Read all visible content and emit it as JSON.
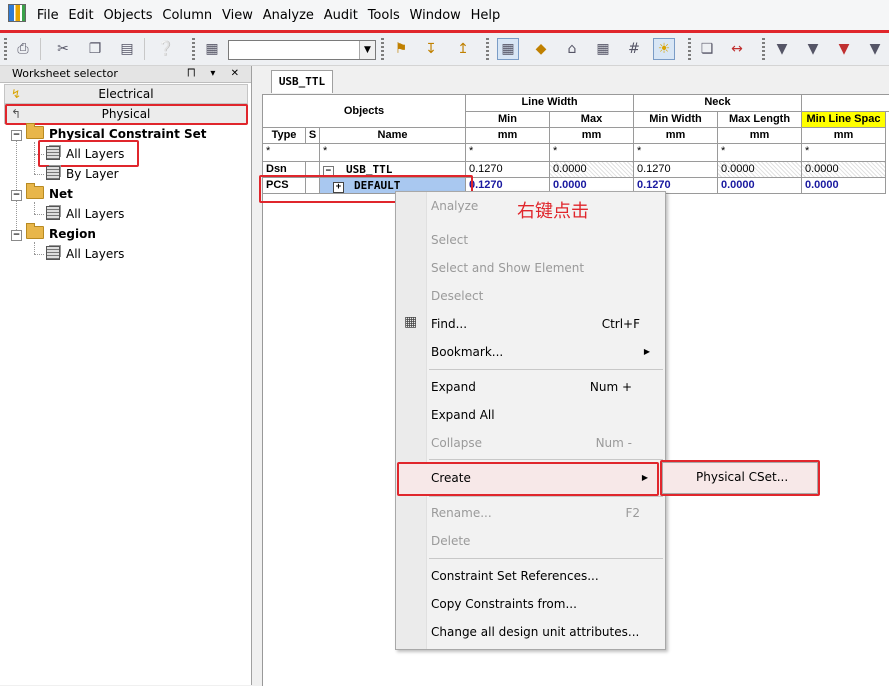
{
  "menubar": [
    "File",
    "Edit",
    "Objects",
    "Column",
    "View",
    "Analyze",
    "Audit",
    "Tools",
    "Window",
    "Help"
  ],
  "left_panel": {
    "title": "Worksheet selector",
    "controls": "⨅ ▾ ✕",
    "electrical": "Electrical",
    "physical": "Physical",
    "tree": [
      {
        "label": "Physical Constraint Set"
      },
      {
        "label": "All Layers"
      },
      {
        "label": "By Layer"
      },
      {
        "label": "Net"
      },
      {
        "label": "All Layers"
      },
      {
        "label": "Region"
      },
      {
        "label": "All Layers"
      }
    ]
  },
  "tab": "USB_TTL",
  "grid": {
    "objects": "Objects",
    "line_width": "Line Width",
    "neck": "Neck",
    "min": "Min",
    "max": "Max",
    "min_width": "Min Width",
    "max_length": "Max Length",
    "min_line_spac": "Min Line Spac",
    "type": "Type",
    "s": "S",
    "name": "Name",
    "unit": "mm",
    "star": "*",
    "rows": [
      {
        "type": "Dsn",
        "name": "USB_TTL",
        "v1": "0.1270",
        "v2": "0.0000",
        "v3": "0.1270",
        "v4": "0.0000",
        "v5": "0.0000",
        "expander": "−"
      },
      {
        "type": "PCS",
        "name": "DEFAULT",
        "v1": "0.1270",
        "v2": "0.0000",
        "v3": "0.1270",
        "v4": "0.0000",
        "v5": "0.0000",
        "expander": "+"
      }
    ]
  },
  "context_menu": {
    "analyze": "Analyze",
    "select": "Select",
    "select_show": "Select and Show Element",
    "deselect": "Deselect",
    "find": "Find...",
    "find_sc": "Ctrl+F",
    "bookmark": "Bookmark...",
    "expand": "Expand",
    "expand_sc": "Num +",
    "expand_all": "Expand All",
    "collapse": "Collapse",
    "collapse_sc": "Num -",
    "create": "Create",
    "rename": "Rename...",
    "rename_sc": "F2",
    "delete": "Delete",
    "cset_refs": "Constraint Set References...",
    "copy_constraints": "Copy Constraints from...",
    "change_units": "Change all design unit attributes..."
  },
  "submenu": {
    "physical_cset": "Physical CSet..."
  },
  "annotation": "右键点击",
  "colors": {
    "highlight_red": "#e0262c",
    "header_yellow": "#ffff00",
    "selected_row": "#a9c8f0"
  }
}
